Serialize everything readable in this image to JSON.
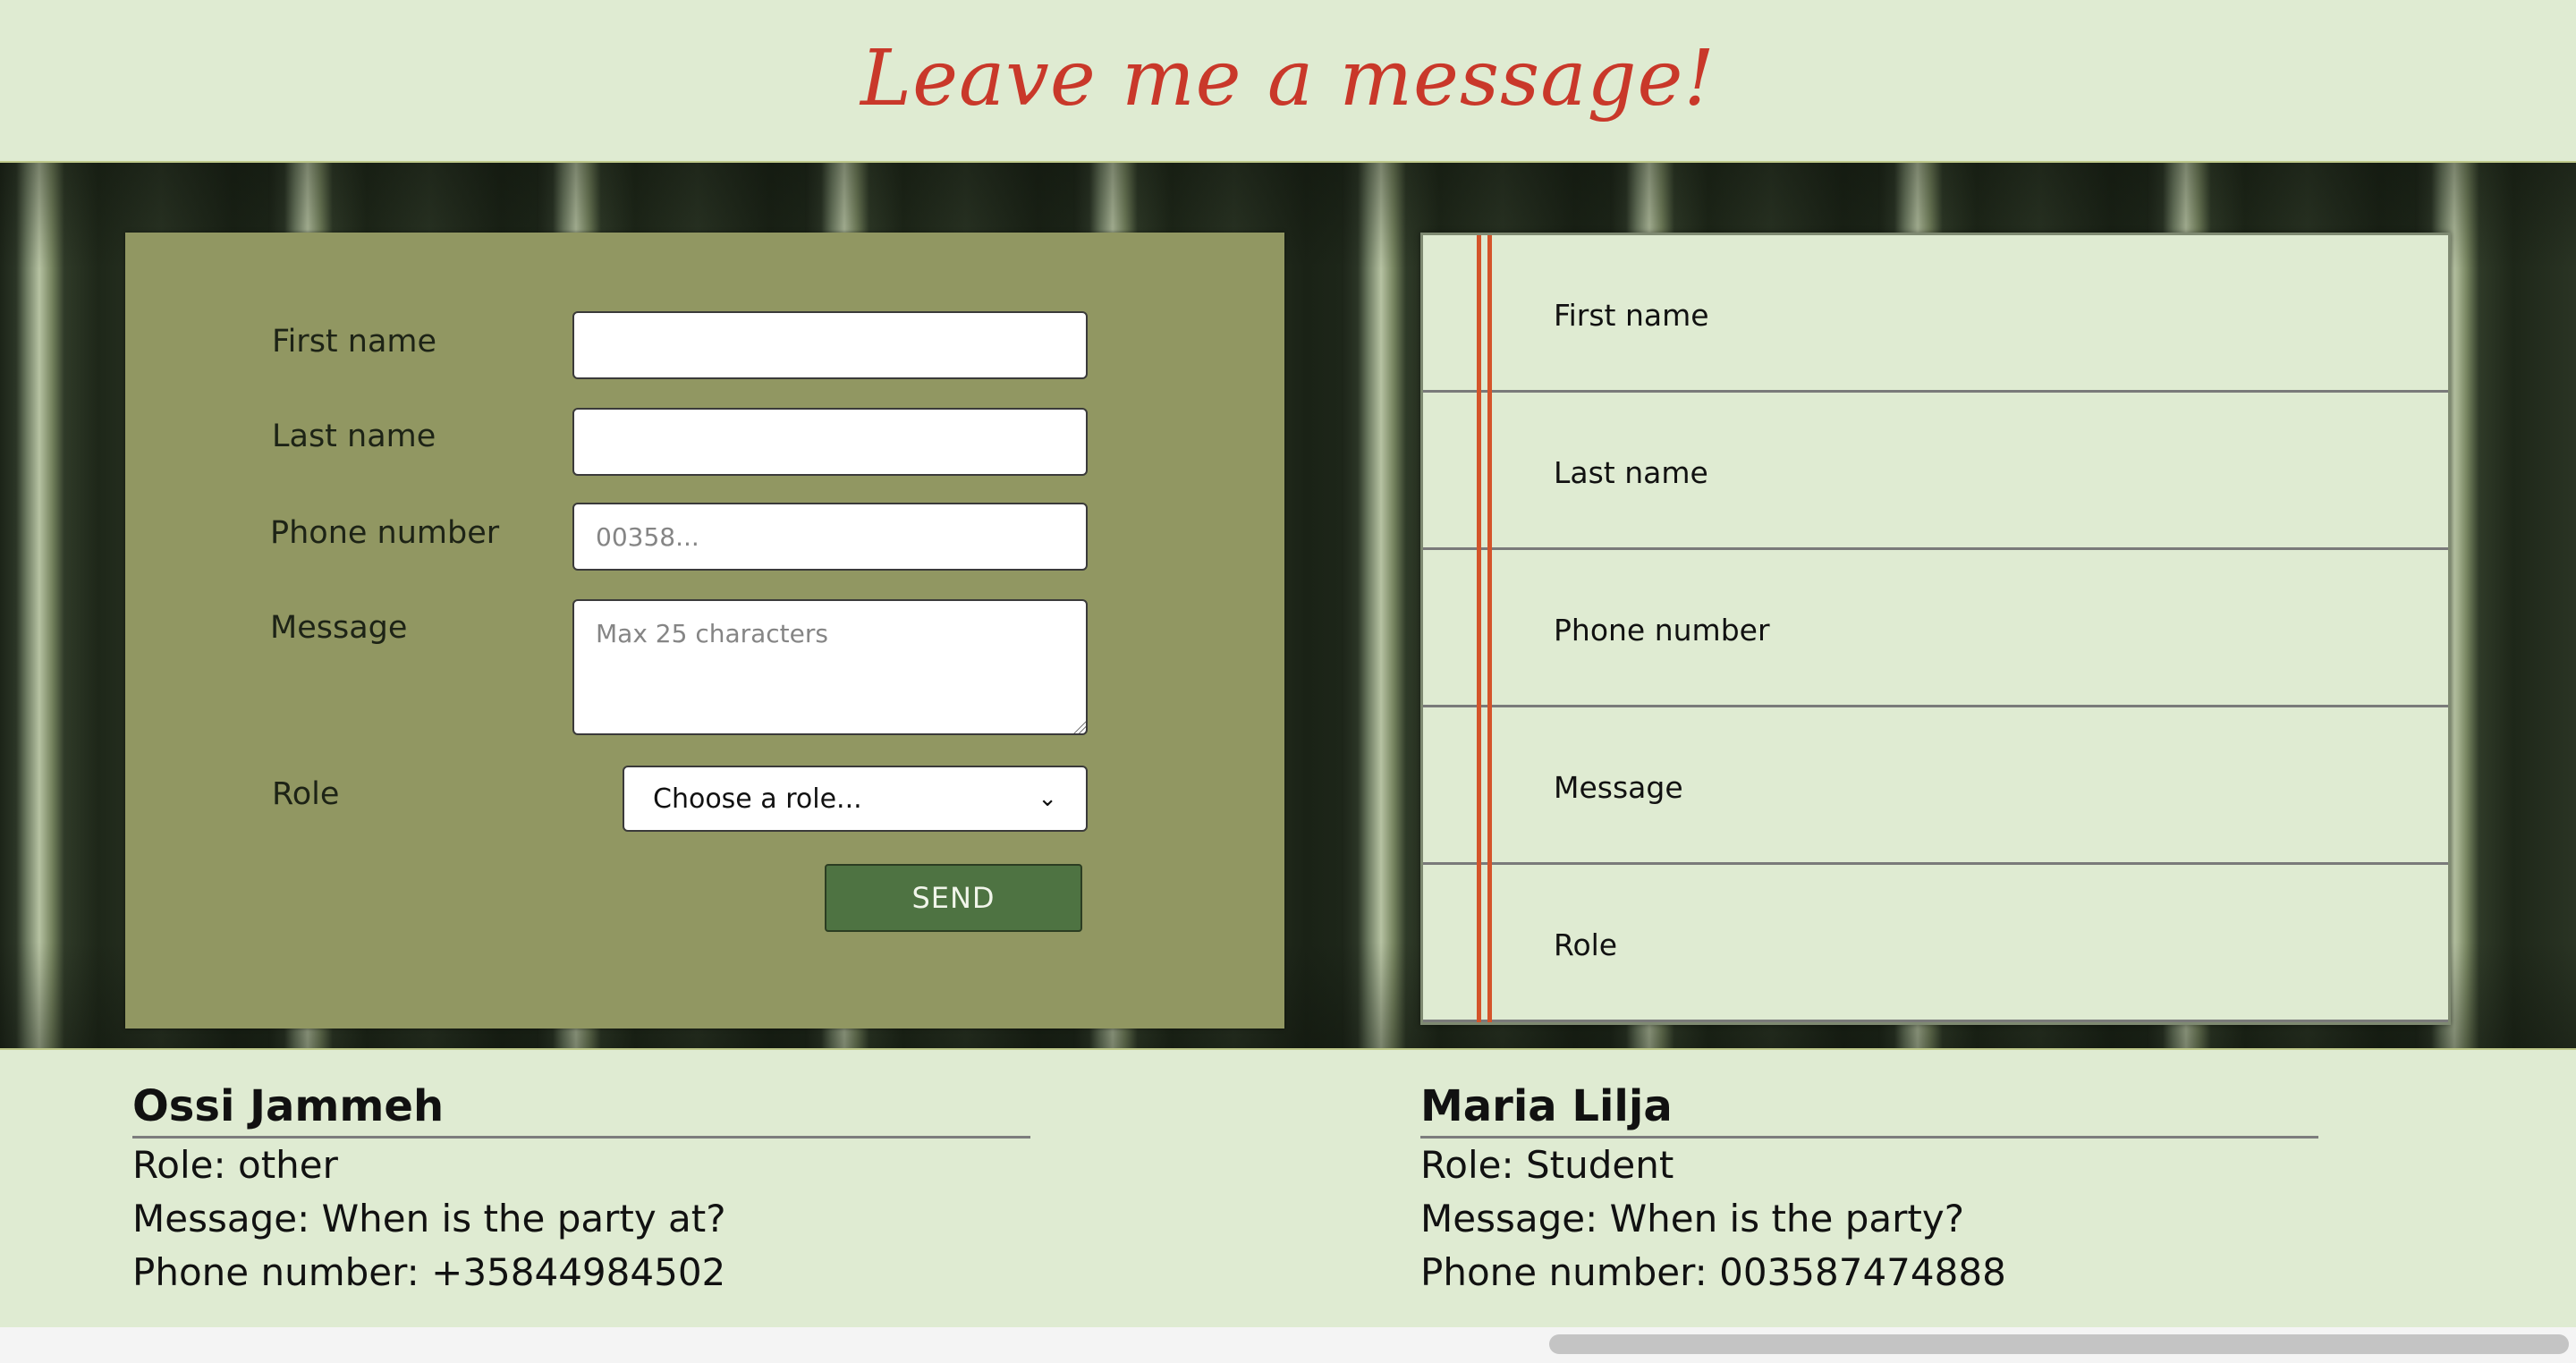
{
  "header": {
    "title": "Leave me a message!"
  },
  "form": {
    "first_name_label": "First name",
    "last_name_label": "Last name",
    "phone_label": "Phone number",
    "phone_placeholder": "00358...",
    "message_label": "Message",
    "message_placeholder": "Max 25 characters",
    "role_label": "Role",
    "role_selected": "Choose a role...",
    "send_label": "SEND"
  },
  "preview": {
    "rows": [
      {
        "label": "First name"
      },
      {
        "label": "Last name"
      },
      {
        "label": "Phone number"
      },
      {
        "label": "Message"
      },
      {
        "label": "Role"
      }
    ]
  },
  "messages": [
    {
      "name": "Ossi Jammeh",
      "role": "Role: other",
      "message": "Message: When is the party at?",
      "phone": "Phone number: +35844984502"
    },
    {
      "name": "Maria Lilja",
      "role": "Role: Student",
      "message": "Message: When is the party?",
      "phone": "Phone number: 003587474888"
    }
  ],
  "colors": {
    "page_bg": "#dfebd2",
    "title": "#c9382a",
    "form_bg": "#919762",
    "send_button": "#4e7342",
    "margin_line": "#d4542a"
  },
  "icons": {
    "select_arrow": "chevron-down-icon",
    "textarea_grip": "resize-grip-icon"
  }
}
